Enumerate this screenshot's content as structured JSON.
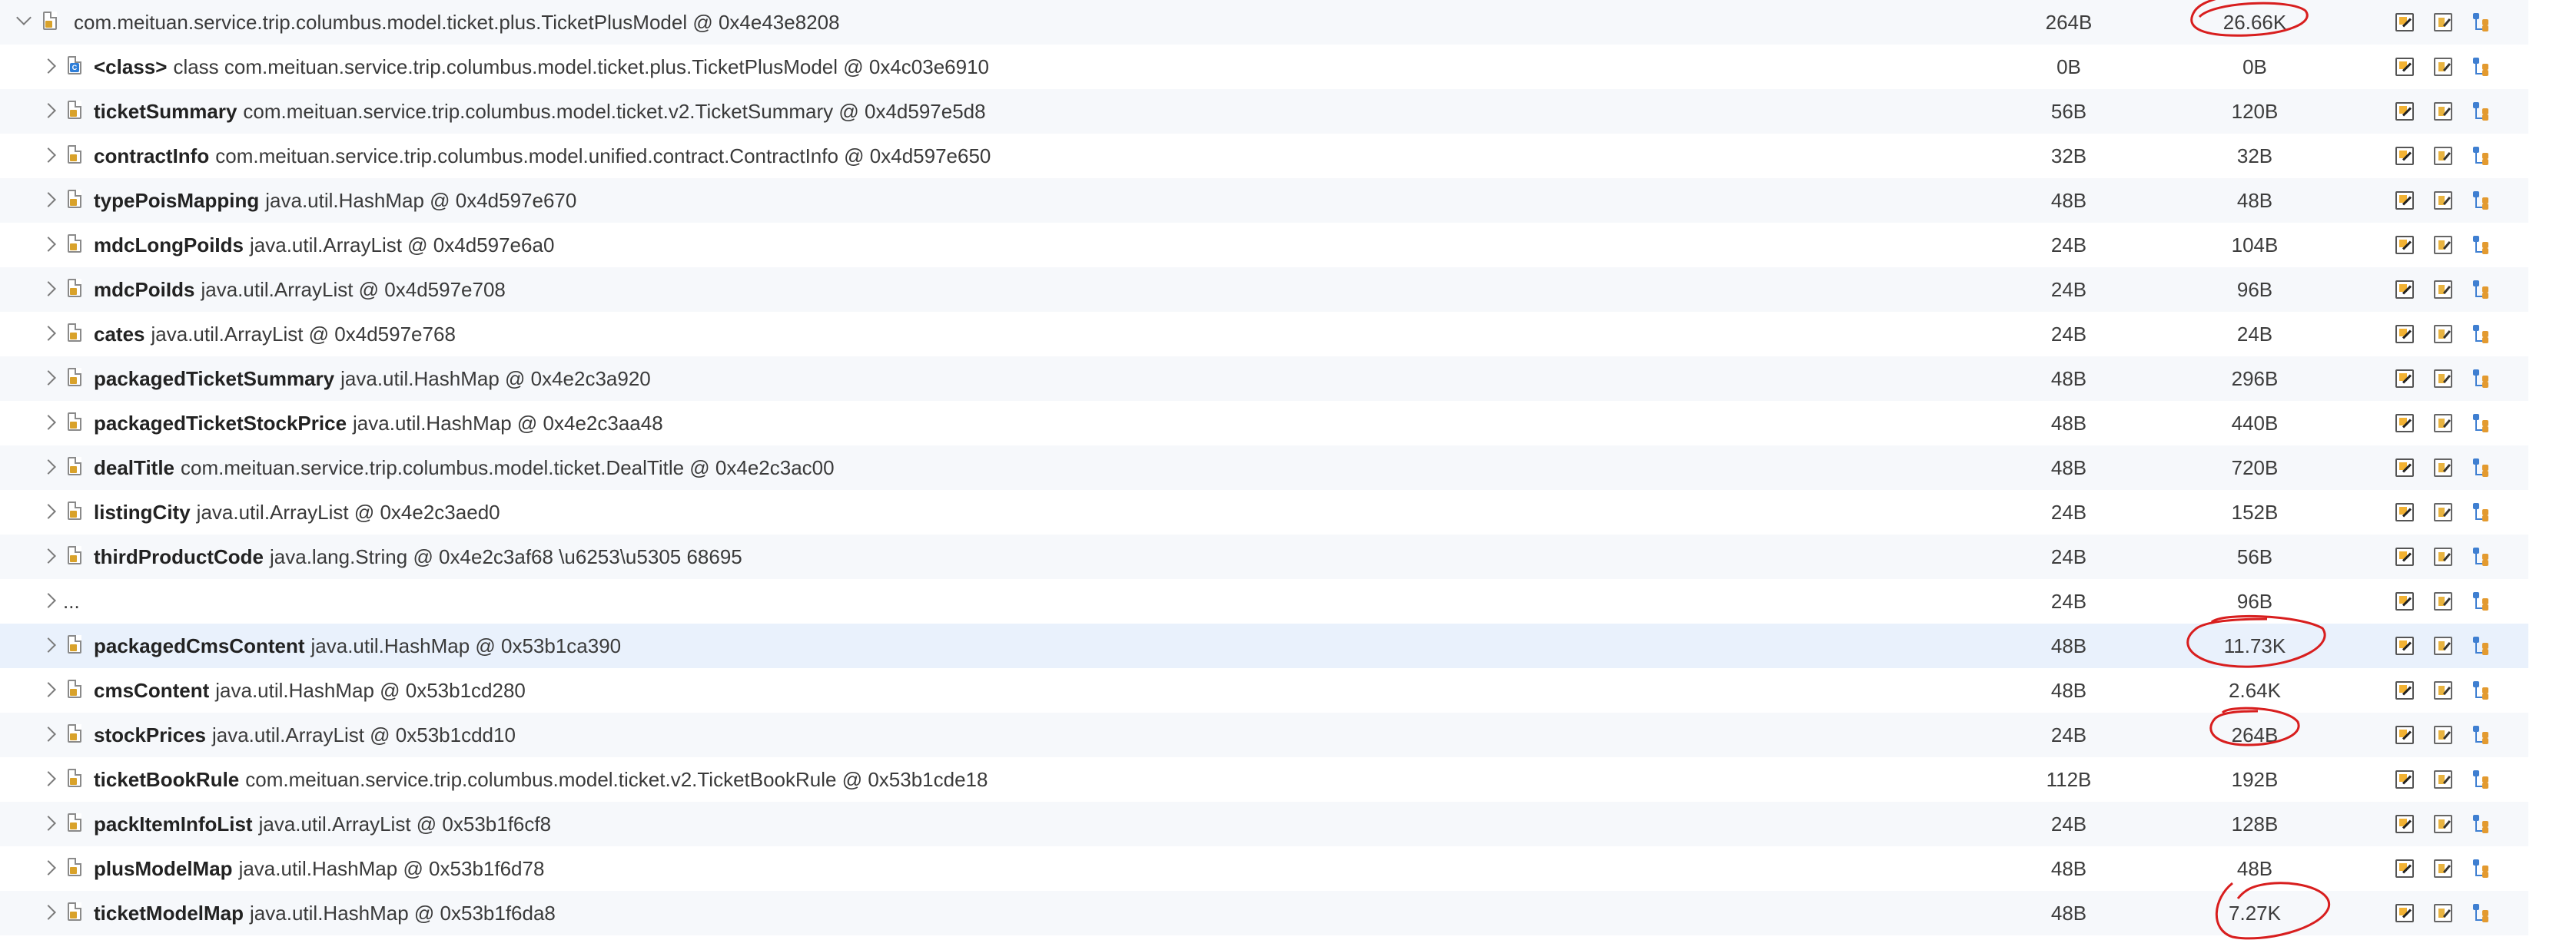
{
  "tree": {
    "root": {
      "name": "",
      "description": "com.meituan.service.trip.columbus.model.ticket.plus.TicketPlusModel @ 0x4e43e8208",
      "shallow": "264B",
      "retained": "26.66K"
    },
    "children": [
      {
        "name": "<class>",
        "description": "class com.meituan.service.trip.columbus.model.ticket.plus.TicketPlusModel @ 0x4c03e6910",
        "shallow": "0B",
        "retained": "0B",
        "icon": "class-file-icon"
      },
      {
        "name": "ticketSummary",
        "description": "com.meituan.service.trip.columbus.model.ticket.v2.TicketSummary @ 0x4d597e5d8",
        "shallow": "56B",
        "retained": "120B"
      },
      {
        "name": "contractInfo",
        "description": "com.meituan.service.trip.columbus.model.unified.contract.ContractInfo @ 0x4d597e650",
        "shallow": "32B",
        "retained": "32B"
      },
      {
        "name": "typePoisMapping",
        "description": "java.util.HashMap @ 0x4d597e670",
        "shallow": "48B",
        "retained": "48B"
      },
      {
        "name": "mdcLongPoiIds",
        "description": "java.util.ArrayList @ 0x4d597e6a0",
        "shallow": "24B",
        "retained": "104B"
      },
      {
        "name": "mdcPoiIds",
        "description": "java.util.ArrayList @ 0x4d597e708",
        "shallow": "24B",
        "retained": "96B"
      },
      {
        "name": "cates",
        "description": "java.util.ArrayList @ 0x4d597e768",
        "shallow": "24B",
        "retained": "24B"
      },
      {
        "name": "packagedTicketSummary",
        "description": "java.util.HashMap @ 0x4e2c3a920",
        "shallow": "48B",
        "retained": "296B"
      },
      {
        "name": "packagedTicketStockPrice",
        "description": "java.util.HashMap @ 0x4e2c3aa48",
        "shallow": "48B",
        "retained": "440B"
      },
      {
        "name": "dealTitle",
        "description": "com.meituan.service.trip.columbus.model.ticket.DealTitle @ 0x4e2c3ac00",
        "shallow": "48B",
        "retained": "720B"
      },
      {
        "name": "listingCity",
        "description": "java.util.ArrayList @ 0x4e2c3aed0",
        "shallow": "24B",
        "retained": "152B"
      },
      {
        "name": "thirdProductCode",
        "description": "java.lang.String @ 0x4e2c3af68 \\u6253\\u5305 68695",
        "shallow": "24B",
        "retained": "56B"
      },
      {
        "name": "",
        "description": "...",
        "shallow": "24B",
        "retained": "96B"
      },
      {
        "name": "packagedCmsContent",
        "description": "java.util.HashMap @ 0x53b1ca390",
        "shallow": "48B",
        "retained": "11.73K"
      },
      {
        "name": "cmsContent",
        "description": "java.util.HashMap @ 0x53b1cd280",
        "shallow": "48B",
        "retained": "2.64K"
      },
      {
        "name": "stockPrices",
        "description": "java.util.ArrayList @ 0x53b1cdd10",
        "shallow": "24B",
        "retained": "264B"
      },
      {
        "name": "ticketBookRule",
        "description": "com.meituan.service.trip.columbus.model.ticket.v2.TicketBookRule @ 0x53b1cde18",
        "shallow": "112B",
        "retained": "192B"
      },
      {
        "name": "packItemInfoList",
        "description": "java.util.ArrayList @ 0x53b1f6cf8",
        "shallow": "24B",
        "retained": "128B"
      },
      {
        "name": "plusModelMap",
        "description": "java.util.HashMap @ 0x53b1f6d78",
        "shallow": "48B",
        "retained": "48B"
      },
      {
        "name": "ticketModelMap",
        "description": "java.util.HashMap @ 0x53b1f6da8",
        "shallow": "48B",
        "retained": "7.27K"
      }
    ]
  },
  "row_actions": [
    "edit-icon",
    "document-icon",
    "tree-icon"
  ],
  "colors": {
    "row_alt": "#f6f8fb",
    "row_selected": "#e9f1fc",
    "annotation": "#d81e1e"
  }
}
